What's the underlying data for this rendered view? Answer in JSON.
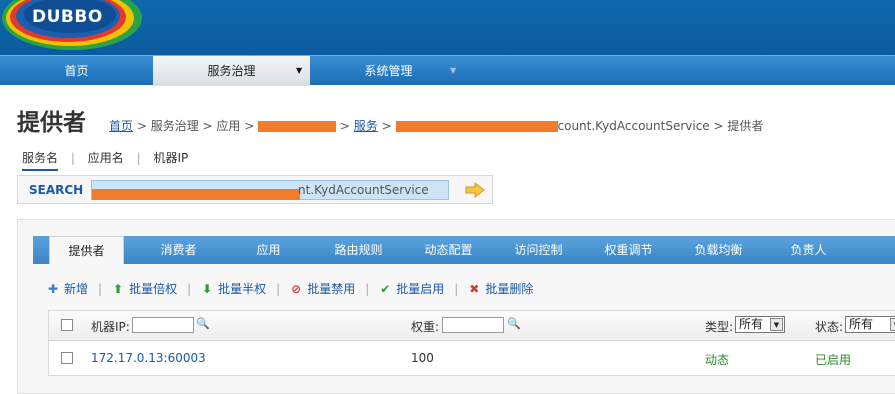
{
  "header": {
    "logo_text": "DUBBO"
  },
  "nav": {
    "items": [
      {
        "label": "首页"
      },
      {
        "label": "服务治理",
        "arrow": "▼"
      },
      {
        "label": "系统管理",
        "arrow": "▼"
      }
    ]
  },
  "page": {
    "title": "提供者",
    "breadcrumb": {
      "home": "首页",
      "sep": " > ",
      "governance": "服务治理",
      "app": "应用",
      "service": "服务",
      "service_suffix": "count.KydAccountService",
      "current": "提供者"
    }
  },
  "search": {
    "tabs": [
      "服务名",
      "应用名",
      "机器IP"
    ],
    "tab_sep": "|",
    "label": "SEARCH",
    "value_suffix": "nt.KydAccountService"
  },
  "tabs": [
    "提供者",
    "消费者",
    "应用",
    "路由规则",
    "动态配置",
    "访问控制",
    "权重调节",
    "负载均衡",
    "负责人"
  ],
  "toolbar": {
    "sep": "|",
    "actions": [
      {
        "icon": "plus-icon",
        "glyph": "✚",
        "color": "#3a7fc1",
        "label": "新增"
      },
      {
        "icon": "arrow-up-icon",
        "glyph": "⬆",
        "color": "#2e9b2e",
        "label": "批量倍权"
      },
      {
        "icon": "arrow-down-icon",
        "glyph": "⬇",
        "color": "#2e9b2e",
        "label": "批量半权"
      },
      {
        "icon": "forbidden-icon",
        "glyph": "⊘",
        "color": "#d23b2a",
        "label": "批量禁用"
      },
      {
        "icon": "check-icon",
        "glyph": "✔",
        "color": "#2e9b2e",
        "label": "批量启用"
      },
      {
        "icon": "delete-icon",
        "glyph": "✖",
        "color": "#d23b2a",
        "label": "批量删除"
      }
    ]
  },
  "grid": {
    "filters": {
      "ip_label": "机器IP:",
      "weight_label": "权重:",
      "type_label": "类型:",
      "type_value": "所有",
      "status_label": "状态:",
      "status_value": "所有"
    },
    "rows": [
      {
        "address": "172.17.0.13:60003",
        "weight": "100",
        "type": "动态",
        "status": "已启用"
      }
    ]
  },
  "colors": {
    "header": "#0f69ad",
    "nav": "#2a7ec4",
    "tabbar": "#4a95d2",
    "link": "#1a5aa8",
    "redaction": "#f07c2c"
  }
}
